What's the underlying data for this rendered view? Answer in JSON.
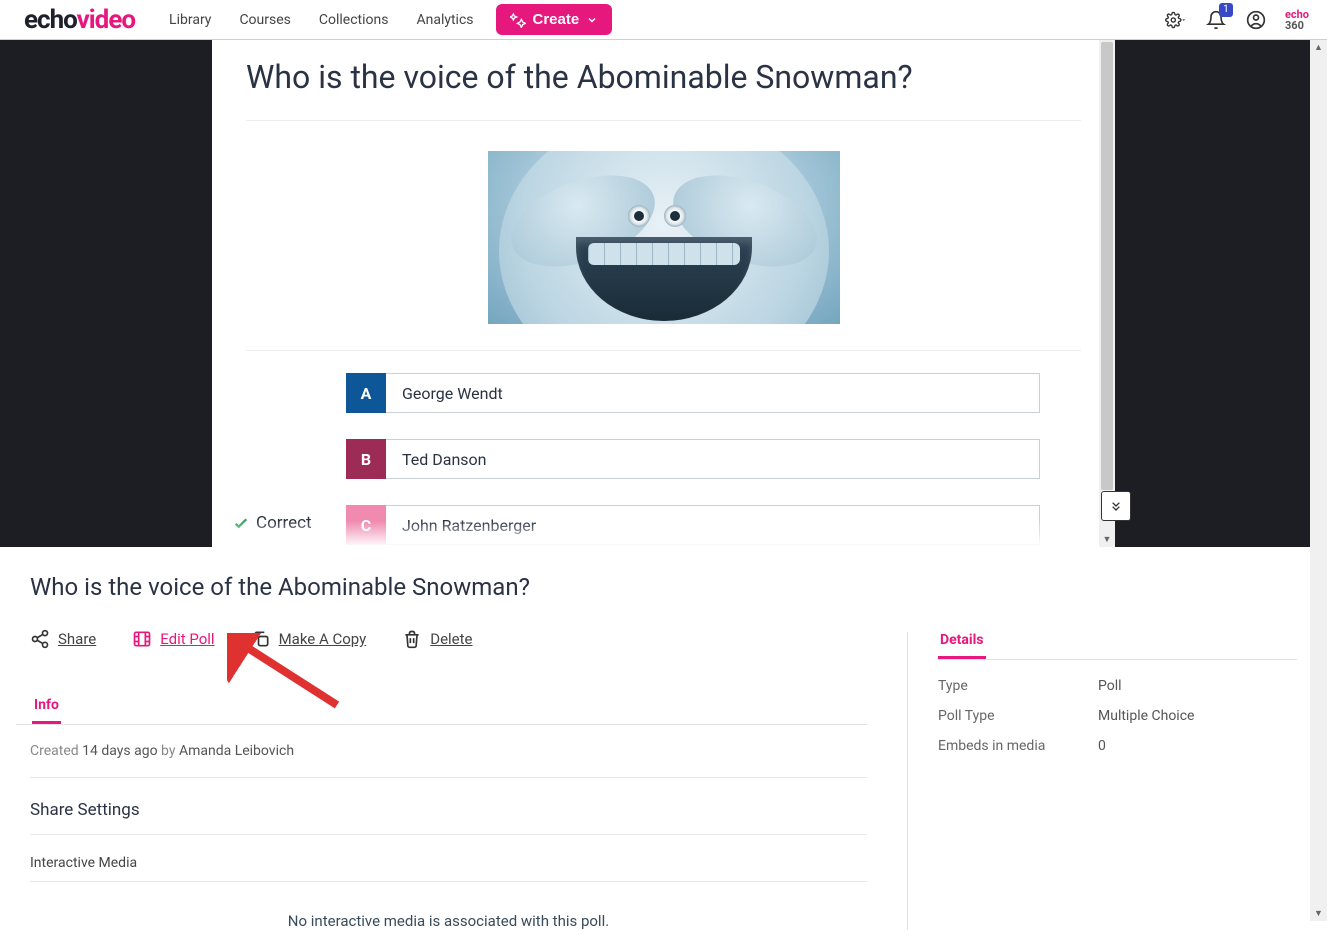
{
  "brand": {
    "part1": "echo",
    "part2": "video"
  },
  "nav": {
    "library": "Library",
    "courses": "Courses",
    "collections": "Collections",
    "analytics": "Analytics"
  },
  "create_button": "Create",
  "notifications_count": "1",
  "mini_logo": {
    "line1": "echo",
    "line2": "360"
  },
  "poll": {
    "question": "Who is the voice of the Abominable Snowman?",
    "answers": [
      {
        "letter": "A",
        "text": "George Wendt"
      },
      {
        "letter": "B",
        "text": "Ted Danson"
      },
      {
        "letter": "C",
        "text": "John Ratzenberger"
      }
    ],
    "correct_label": "Correct"
  },
  "lower_title": "Who is the voice of the Abominable Snowman?",
  "actions": {
    "share": "Share",
    "edit": "Edit Poll",
    "copy": "Make A Copy",
    "delete": "Delete"
  },
  "tabs": {
    "info": "Info",
    "details": "Details"
  },
  "created": {
    "prefix": "Created",
    "when": "14 days ago",
    "by": "by",
    "user": "Amanda Leibovich"
  },
  "share_settings_h": "Share Settings",
  "interactive_media_h": "Interactive Media",
  "no_media_msg": "No interactive media is associated with this poll.",
  "details_kv": {
    "type_k": "Type",
    "type_v": "Poll",
    "polltype_k": "Poll Type",
    "polltype_v": "Multiple Choice",
    "embeds_k": "Embeds in media",
    "embeds_v": "0"
  }
}
